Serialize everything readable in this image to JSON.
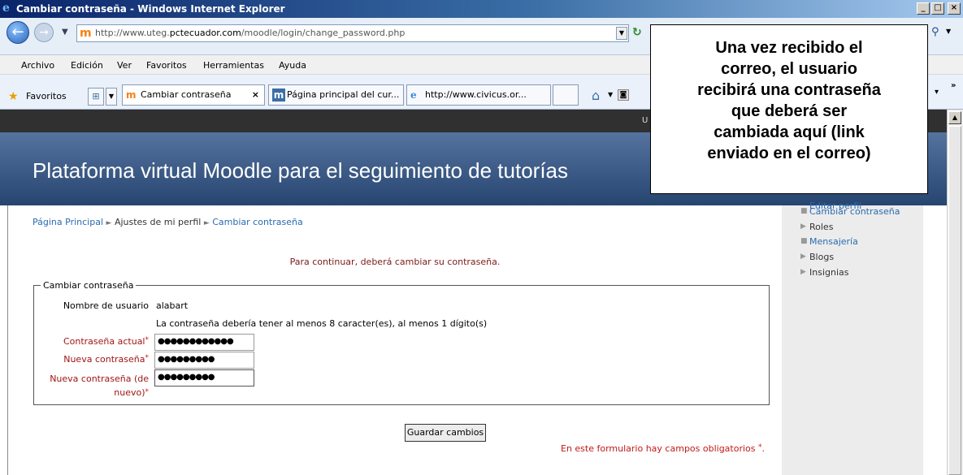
{
  "window": {
    "title": "Cambiar contraseña - Windows Internet Explorer",
    "controls": {
      "minimize": "_",
      "maximize": "□",
      "close": "×"
    }
  },
  "address_bar": {
    "url_prefix": "http://www.uteg.",
    "url_domain": "pctecuador.com",
    "url_path": "/moodle/login/change_password.php"
  },
  "menu": [
    "Archivo",
    "Edición",
    "Ver",
    "Favoritos",
    "Herramientas",
    "Ayuda"
  ],
  "favorites_bar": {
    "favorites_label": "Favoritos",
    "tabs": [
      {
        "label": "Cambiar contraseña",
        "active": true,
        "close": "×"
      },
      {
        "label": "Página principal del cur...",
        "active": false
      },
      {
        "label": "http://www.civicus.or...",
        "active": false
      }
    ]
  },
  "page": {
    "dark_bar_text": "U",
    "site_title": "Plataforma virtual Moodle para el seguimiento de tutorías",
    "breadcrumb": {
      "home": "Página Principal",
      "separator": "►",
      "profile_settings": "Ajustes de mi perfil",
      "current": "Cambiar contraseña"
    },
    "notice": "Para continuar, deberá cambiar su contraseña.",
    "form": {
      "legend": "Cambiar contraseña",
      "username_label": "Nombre de usuario",
      "username_value": "alabart",
      "policy": "La contraseña debería tener al menos 8 caracter(es), al menos 1 dígito(s)",
      "current_password_label": "Contraseña actual",
      "current_password_value": "●●●●●●●●●●●●",
      "new_password_label": "Nueva contraseña",
      "new_password_value": "●●●●●●●●●",
      "new_password_again_label_1": "Nueva contraseña (de",
      "new_password_again_label_2": "nuevo)",
      "new_password_again_value": "●●●●●●●●●",
      "required_mark": "*",
      "save_button": "Guardar cambios",
      "required_note": "En este formulario hay campos obligatorios"
    },
    "sidebar": {
      "partial_top": "Editar perfil",
      "items": [
        {
          "label": "Cambiar contraseña",
          "link": true,
          "bullet": "■"
        },
        {
          "label": "Roles",
          "link": false,
          "bullet": "▶"
        },
        {
          "label": "Mensajería",
          "link": true,
          "bullet": "■"
        },
        {
          "label": "Blogs",
          "link": false,
          "bullet": "▶"
        },
        {
          "label": "Insignias",
          "link": false,
          "bullet": "▶"
        }
      ]
    }
  },
  "callout": {
    "text": "Una vez recibido el\ncorreo, el usuario\nrecibirá una contraseña\nque deberá ser\ncambiada aquí   (link\nenviado en el correo)"
  },
  "colors": {
    "titlebar": "#0a246a",
    "banner": "#26456f",
    "link": "#2a6bb0",
    "required": "#d01515"
  }
}
